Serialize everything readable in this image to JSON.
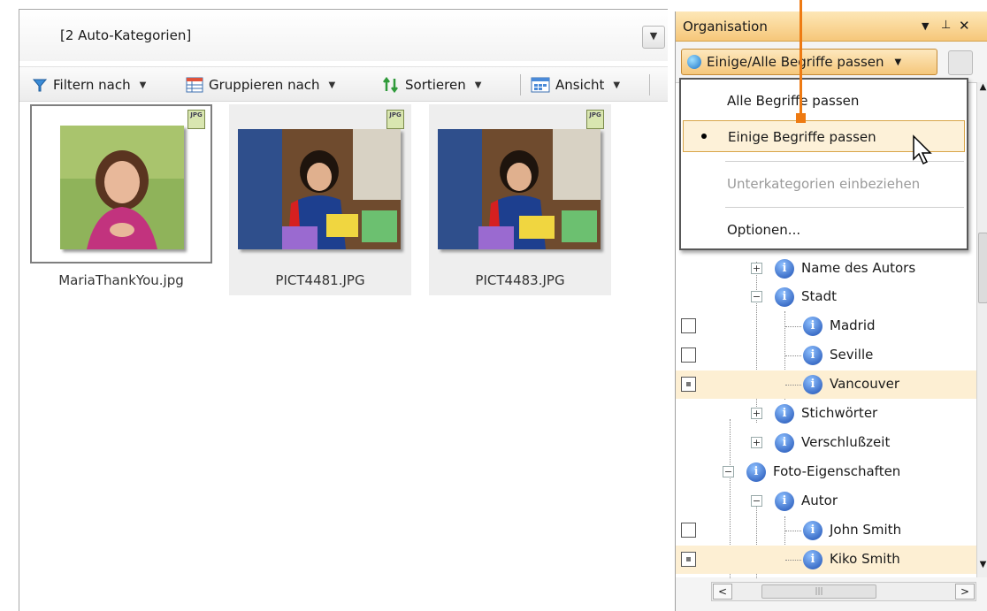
{
  "left_pane": {
    "category_label": "[2 Auto-Kategorien]",
    "toolbar": {
      "filter": "Filtern nach",
      "group": "Gruppieren nach",
      "sort": "Sortieren",
      "view": "Ansicht"
    },
    "thumbnails": [
      {
        "caption": "MariaThankYou.jpg",
        "badge": "JPG",
        "selected": true
      },
      {
        "caption": "PICT4481.JPG",
        "badge": "JPG",
        "selected": false
      },
      {
        "caption": "PICT4483.JPG",
        "badge": "JPG",
        "selected": false
      }
    ]
  },
  "organizer": {
    "title": "Organisation",
    "match_dropdown": "Einige/Alle Begriffe passen",
    "menu": {
      "all_terms": "Alle Begriffe passen",
      "some_terms": "Einige Begriffe passen",
      "include_subcategories": "Unterkategorien einbeziehen",
      "options": "Optionen..."
    },
    "tree": [
      {
        "label": "Name des Autors"
      },
      {
        "label": "Stadt"
      },
      {
        "label": "Madrid"
      },
      {
        "label": "Seville"
      },
      {
        "label": "Vancouver"
      },
      {
        "label": "Stichwörter"
      },
      {
        "label": "Verschlußzeit"
      },
      {
        "label": "Foto-Eigenschaften"
      },
      {
        "label": "Autor"
      },
      {
        "label": "John Smith"
      },
      {
        "label": "Kiko Smith"
      }
    ]
  },
  "colors": {
    "accent_orange": "#ee7a12",
    "header_gradient": "#f6c77a",
    "highlight_row": "#fdefd3"
  }
}
